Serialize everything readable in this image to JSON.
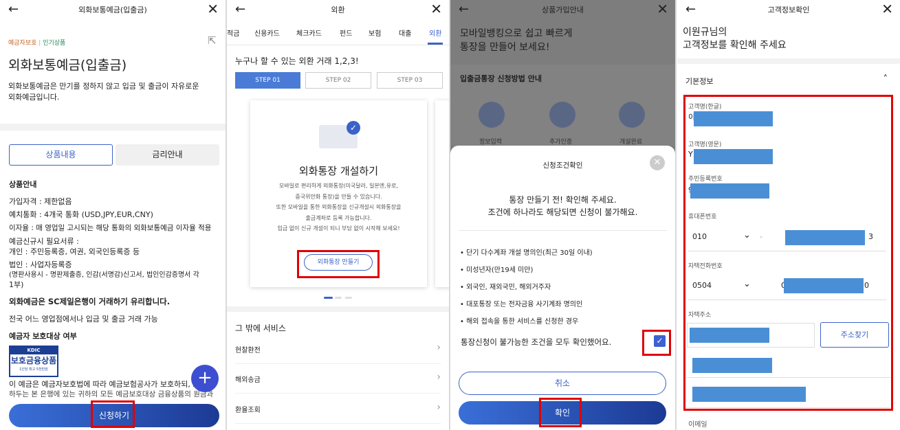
{
  "s1": {
    "title": "외화보통예금(입출금)",
    "badge1": "예금자보호",
    "badge_sep": "|",
    "badge2": "인기상품",
    "product_name": "외화보통예금(입출금)",
    "desc1": "외화보통예금은 만기를 정하지 않고 입금 및 출금이 자유로운",
    "desc2": "외화예금입니다.",
    "tab1": "상품내용",
    "tab2": "금리안내",
    "section": "상품안내",
    "lines": [
      "가입자격 : 제한없음",
      "예치통화 : 4개국 통화 (USD,JPY,EUR,CNY)",
      "이자율 : 매 영업일 고시되는 해당 통화의 외화보통예금 이자율 적용",
      "예금신규시 필요서류 :",
      "개인 : 주민등록증, 여권, 외국인등록증 등",
      "법인 : 사업자등록증",
      "(명판사용시 - 명판제출증, 인감(서명감)신고서, 법인인감증명서 각",
      "1부)"
    ],
    "bold1": "외화예금은 SC제일은행이 거래하기 유리합니다.",
    "line9": "전국 어느 영업점에서나 입금 및 출금 거래 가능",
    "bold2": "예금자 보호대상 여부",
    "kdic_top": "KDIC",
    "kdic_main": "보호금융상품",
    "kdic_sub": "1인당 최고 5천만원",
    "note1": "이 예금은 예금자보호법에 따라 예금보험공사가 보호하되, 보",
    "note2": "하두는 본 은행에 있는 귀하의 모든 예금보호대상 금융상품의 원금과",
    "apply": "신청하기",
    "fab": "+"
  },
  "s2": {
    "title": "외환",
    "tabs": [
      "적금",
      "신용카드",
      "체크카드",
      "펀드",
      "보험",
      "대출",
      "외환"
    ],
    "headline": "누구나 할 수 있는 외환 거래 1,2,3!",
    "steps": [
      "STEP 01",
      "STEP 02",
      "STEP 03"
    ],
    "card_title": "외화통장 개설하기",
    "card_lines": [
      "모바일로 편리하게 외화통장(미국달러, 일본엔,유로,",
      "중국위안화 통장)을 만들 수 있습니다.",
      "또한 모바일을 통한 외화통장을 신규개설시 외화통장을",
      "출금계좌로 등록 가능합니다.",
      "입금 없이 신규 개설이 되니 부담 없이 시작해 보세요!"
    ],
    "card_button": "외화통장 만들기",
    "other": "그 밖에 서비스",
    "list": [
      "현찰환전",
      "해외송금",
      "환율조회"
    ]
  },
  "s3": {
    "title": "상품가입안내",
    "hero1": "모바일뱅킹으로 쉽고 빠르게",
    "hero2": "통장을 만들어 보세요!",
    "howto": "입출금통장 신청방법 안내",
    "step_labels": [
      "정보입력",
      "추가인증",
      "개설완료"
    ],
    "modal_title": "신청조건확인",
    "q1": "통장 만들기 전! 확인해 주세요.",
    "q2": "조건에 하나라도 해당되면 신청이 불가해요.",
    "conds": [
      "단기 다수계좌 개설 명의인(최근 30일 이내)",
      "미성년자(만19세 미만)",
      "외국인, 재외국민, 해외거주자",
      "대포통장 또는 전자금융 사기계좌 명의인",
      "해외 접속을 통한 서비스를 신청한 경우"
    ],
    "confirm_text": "통장신청이 불가능한 조건을 모두 확인했어요.",
    "cancel": "취소",
    "ok": "확인"
  },
  "s4": {
    "title": "고객정보확인",
    "greet1": "이원규님의",
    "greet2": "고객정보를 확인해 주세요",
    "section": "기본정보",
    "kname": "고객명(한글)",
    "kname_v": "이",
    "ename": "고객명(영문)",
    "ename_v": "Y",
    "rrn": "주민등록번호",
    "rrn_v": "9",
    "phone": "휴대폰번호",
    "phone_pre": "010",
    "phone_dash": "-",
    "phone_end": "3",
    "home": "자택전화번호",
    "home_pre": "0504",
    "home_mid": "0",
    "home_end": "0",
    "addr": "자택주소",
    "addr_btn": "주소찾기",
    "email": "이메일"
  }
}
